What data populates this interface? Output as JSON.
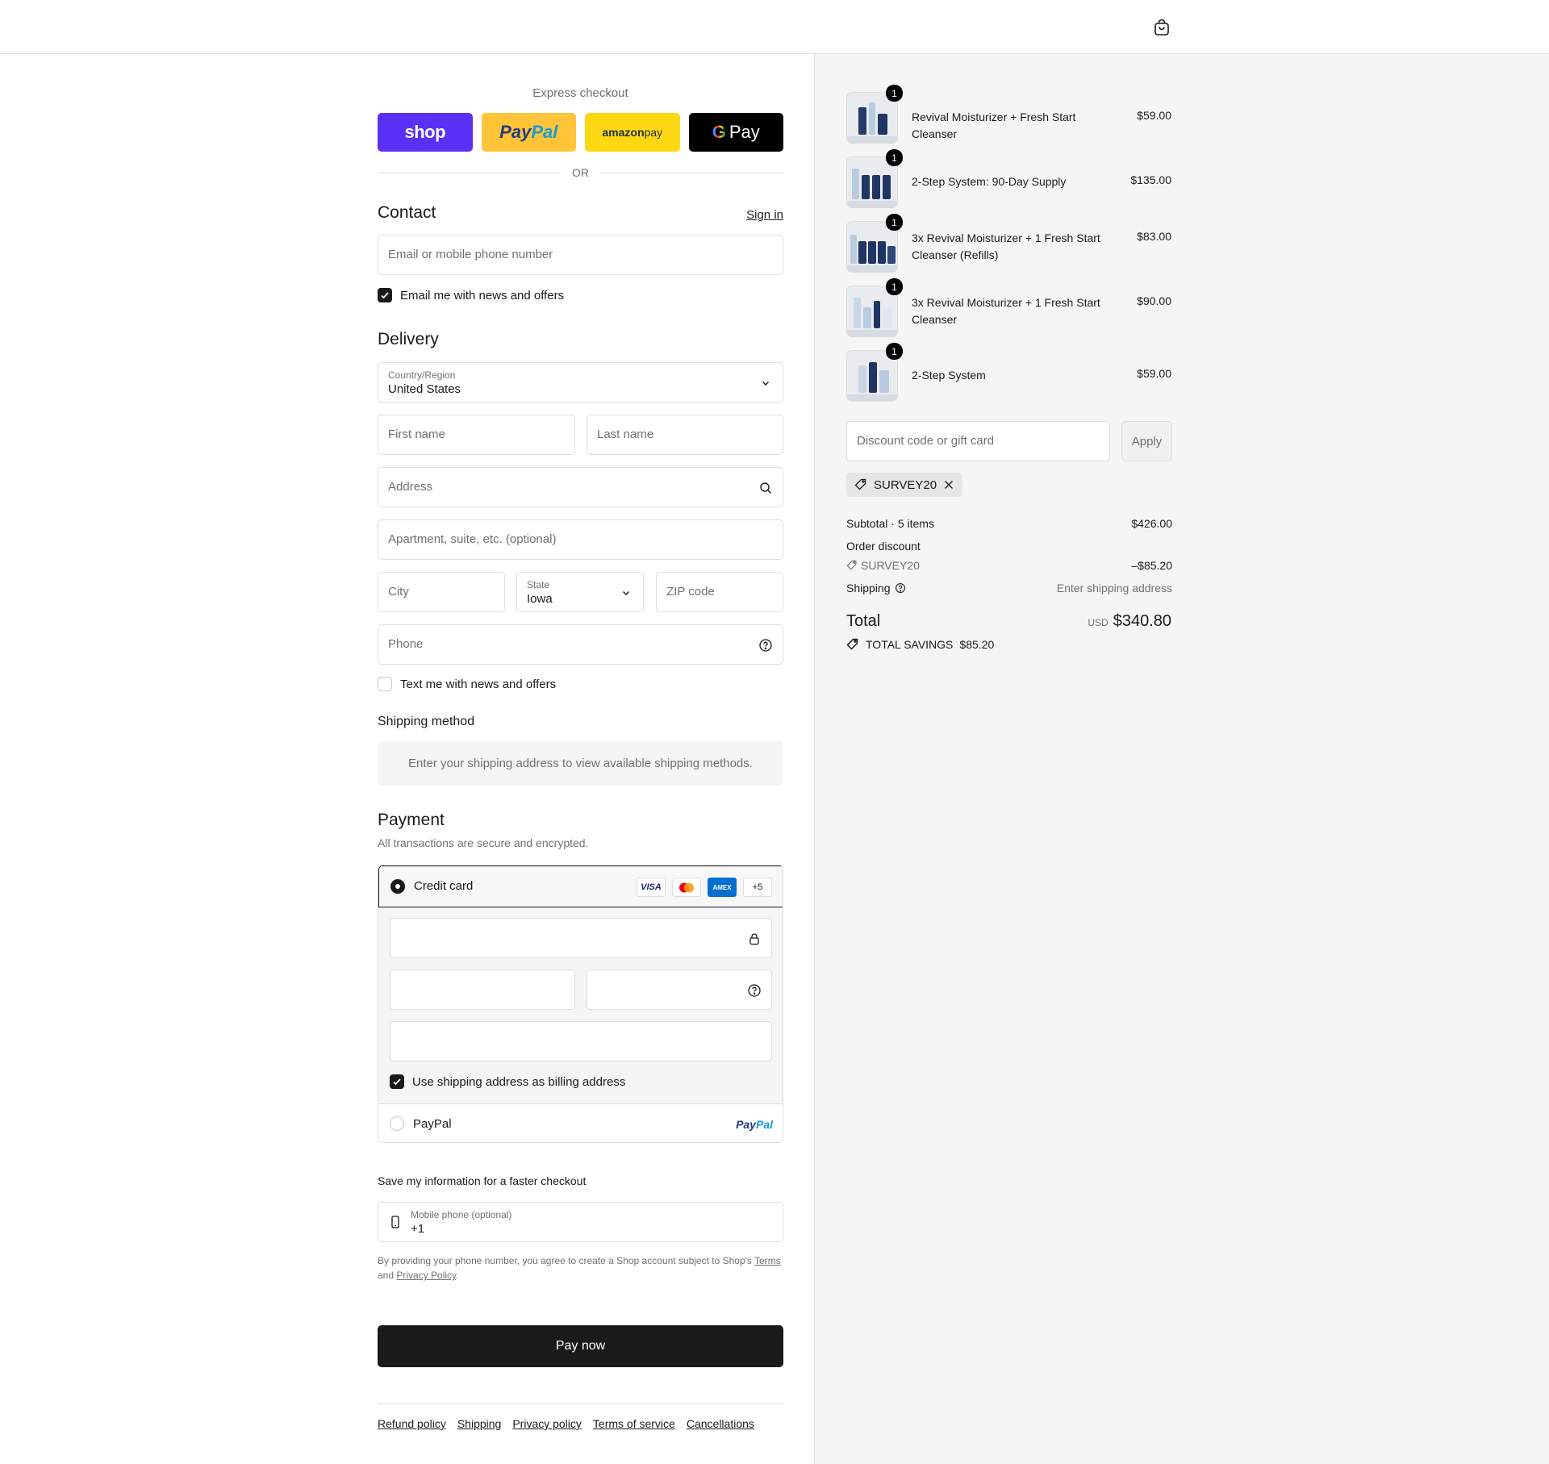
{
  "express": {
    "title": "Express checkout",
    "shop": "shop",
    "paypal_a": "Pay",
    "paypal_b": "Pal",
    "amazon_a": "amazon",
    "amazon_b": " pay",
    "gpay_g": "G",
    "gpay_text": "Pay",
    "or": "OR"
  },
  "contact": {
    "title": "Contact",
    "signin": "Sign in",
    "email_placeholder": "Email or mobile phone number",
    "news_label": "Email me with news and offers",
    "news_checked": true
  },
  "delivery": {
    "title": "Delivery",
    "country_label": "Country/Region",
    "country_value": "United States",
    "first_name": "First name",
    "last_name": "Last name",
    "address": "Address",
    "apartment": "Apartment, suite, etc. (optional)",
    "city": "City",
    "state_label": "State",
    "state_value": "Iowa",
    "zip": "ZIP code",
    "phone": "Phone",
    "text_label": "Text me with news and offers",
    "text_checked": false
  },
  "shipping_method": {
    "title": "Shipping method",
    "info": "Enter your shipping address to view available shipping methods."
  },
  "payment": {
    "title": "Payment",
    "desc": "All transactions are secure and encrypted.",
    "credit_card": "Credit card",
    "card_logos": [
      "VISA",
      "",
      "AMEX",
      "+5"
    ],
    "billing_label": "Use shipping address as billing address",
    "billing_checked": true,
    "paypal": "PayPal",
    "paypal_logo_a": "Pay",
    "paypal_logo_b": "Pal"
  },
  "save_info": {
    "title": "Save my information for a faster checkout",
    "mobile_label": "Mobile phone (optional)",
    "mobile_value": "+1",
    "terms_pre": "By providing your phone number, you agree to create a Shop account subject to Shop's ",
    "terms_link": "Terms",
    "terms_mid": " and ",
    "privacy_link": "Privacy Policy",
    "terms_end": "."
  },
  "pay_now": "Pay now",
  "footer_links": [
    "Refund policy",
    "Shipping",
    "Privacy policy",
    "Terms of service",
    "Cancellations"
  ],
  "order": {
    "items": [
      {
        "name": "Revival Moisturizer + Fresh Start Cleanser",
        "price": "$59.00",
        "qty": "1"
      },
      {
        "name": "2-Step System: 90-Day Supply",
        "price": "$135.00",
        "qty": "1"
      },
      {
        "name": "3x Revival Moisturizer + 1 Fresh Start Cleanser (Refills)",
        "price": "$83.00",
        "qty": "1"
      },
      {
        "name": "3x Revival Moisturizer + 1 Fresh Start Cleanser",
        "price": "$90.00",
        "qty": "1"
      },
      {
        "name": "2-Step System",
        "price": "$59.00",
        "qty": "1"
      }
    ],
    "discount_placeholder": "Discount code or gift card",
    "apply": "Apply",
    "applied_code": "SURVEY20",
    "subtotal_label": "Subtotal · 5 items",
    "subtotal_value": "$426.00",
    "order_discount_label": "Order discount",
    "discount_code": "SURVEY20",
    "discount_value": "–$85.20",
    "shipping_label": "Shipping",
    "shipping_value": "Enter shipping address",
    "total_label": "Total",
    "currency": "USD",
    "total_value": "$340.80",
    "savings_label": "TOTAL SAVINGS",
    "savings_value": "$85.20"
  }
}
